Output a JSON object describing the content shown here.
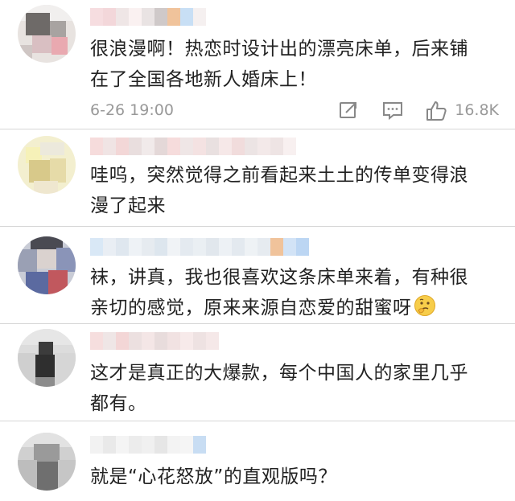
{
  "comments": [
    {
      "text": "很浪漫啊！热恋时设计出的漂亮床单，后来铺在了全国各地新人婚床上！",
      "line1": "很浪漫啊！热恋时设计出的漂亮床单，后来铺",
      "line2": "在了全国各地新人婚床上！",
      "time": "6-26 19:00",
      "likes": "16.8K",
      "icons": [
        "share-icon",
        "comment-icon",
        "like-icon"
      ]
    },
    {
      "line1": "哇呜，突然觉得之前看起来土土的传单变得浪",
      "line2": "漫了起来"
    },
    {
      "line1": "袜，讲真，我也很喜欢这条床单来着，有种很",
      "line2": "亲切的感觉，原来来源自恋爱的甜蜜呀",
      "emoji": "thinking-face-emoji"
    },
    {
      "line1": "这才是真正的大爆款，每个中国人的家里几乎",
      "line2": "都有。"
    },
    {
      "line1": "就是“心花怒放”的直观版吗？"
    }
  ],
  "colors": {
    "text": "#222222",
    "meta": "#999999",
    "divider": "#d6d6d6"
  }
}
